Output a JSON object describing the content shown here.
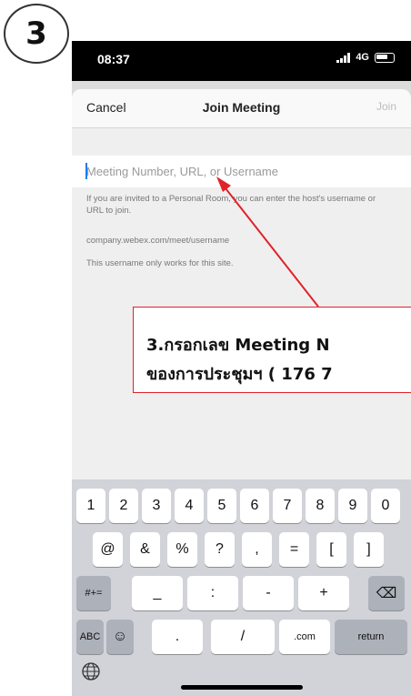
{
  "step": {
    "number": "3"
  },
  "status_bar": {
    "time": "08:37",
    "network": "4G"
  },
  "nav": {
    "cancel": "Cancel",
    "title": "Join Meeting",
    "join": "Join"
  },
  "meeting_input": {
    "placeholder": "Meeting Number, URL, or Username",
    "value": ""
  },
  "help": {
    "line1": "If you are invited to a Personal Room, you can enter the host's username or URL to join.",
    "line2": "company.webex.com/meet/username",
    "line3": "This username only works for this site."
  },
  "callout": {
    "line1": "3.กรอกเลข Meeting N",
    "line2": "ของการประชุมฯ ( 176 7"
  },
  "keyboard": {
    "row1": [
      "1",
      "2",
      "3",
      "4",
      "5",
      "6",
      "7",
      "8",
      "9",
      "0"
    ],
    "row2": [
      "@",
      "&",
      "%",
      "?",
      ",",
      "=",
      "[",
      "]"
    ],
    "row3": {
      "shift": "#+=",
      "keys": [
        "_",
        ":",
        "-",
        "+"
      ],
      "delete": "⌫"
    },
    "row4": {
      "abc": "ABC",
      "emoji": "☺",
      "dot": ".",
      "slash": "/",
      "dotcom": ".com",
      "return": "return"
    }
  },
  "colors": {
    "callout_border": "#e0222a",
    "arrow": "#e0222a",
    "caret": "#1e7cf3",
    "keyboard_bg": "#d1d3d9"
  }
}
